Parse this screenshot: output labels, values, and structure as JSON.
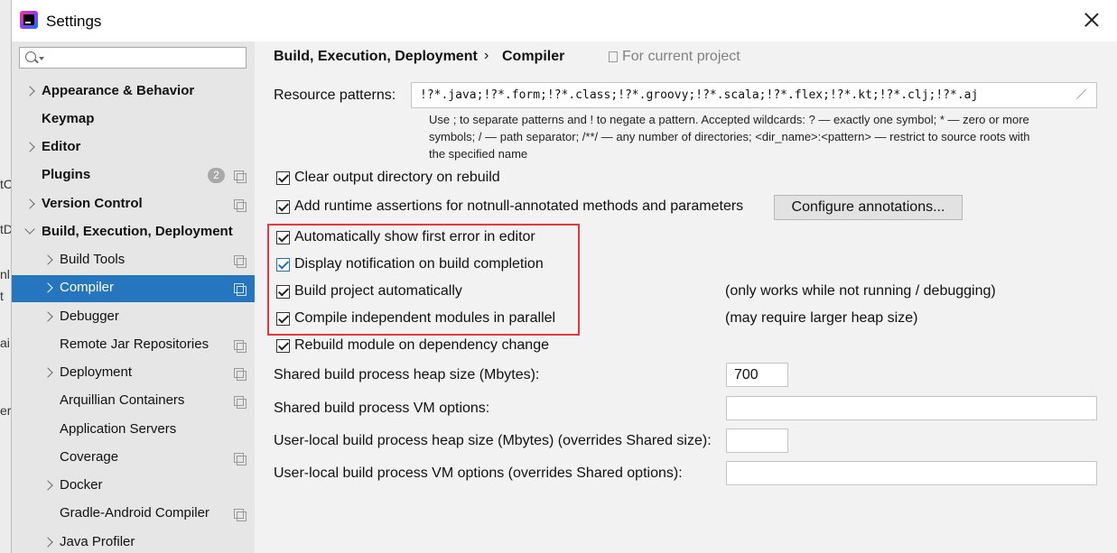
{
  "window": {
    "title": "Settings"
  },
  "background_strip": [
    "tC",
    "tD",
    "nl",
    "t",
    "ai",
    "er"
  ],
  "sidebar": {
    "search_placeholder": "",
    "items": [
      {
        "label": "Appearance & Behavior",
        "bold": true,
        "arrow": "right",
        "level": 0
      },
      {
        "label": "Keymap",
        "bold": true,
        "arrow": "none",
        "level": 0
      },
      {
        "label": "Editor",
        "bold": true,
        "arrow": "right",
        "level": 0
      },
      {
        "label": "Plugins",
        "bold": true,
        "arrow": "none",
        "level": 0,
        "badge": "2",
        "copy": true
      },
      {
        "label": "Version Control",
        "bold": true,
        "arrow": "right",
        "level": 0,
        "copy": true
      },
      {
        "label": "Build, Execution, Deployment",
        "bold": true,
        "arrow": "down",
        "level": 0
      },
      {
        "label": "Build Tools",
        "arrow": "right",
        "level": 1,
        "copy": true
      },
      {
        "label": "Compiler",
        "arrow": "right",
        "level": 1,
        "copy": true,
        "selected": true
      },
      {
        "label": "Debugger",
        "arrow": "right",
        "level": 1
      },
      {
        "label": "Remote Jar Repositories",
        "arrow": "none",
        "level": 1,
        "copy": true
      },
      {
        "label": "Deployment",
        "arrow": "right",
        "level": 1,
        "copy": true
      },
      {
        "label": "Arquillian Containers",
        "arrow": "none",
        "level": 1,
        "copy": true
      },
      {
        "label": "Application Servers",
        "arrow": "none",
        "level": 1
      },
      {
        "label": "Coverage",
        "arrow": "none",
        "level": 1,
        "copy": true
      },
      {
        "label": "Docker",
        "arrow": "right",
        "level": 1
      },
      {
        "label": "Gradle-Android Compiler",
        "arrow": "none",
        "level": 1,
        "copy": true
      },
      {
        "label": "Java Profiler",
        "arrow": "right",
        "level": 1
      }
    ]
  },
  "breadcrumb": {
    "parent": "Build, Execution, Deployment",
    "separator": "›",
    "current": "Compiler",
    "scope_note": "For current project"
  },
  "resource_patterns": {
    "label": "Resource patterns:",
    "value": "!?*.java;!?*.form;!?*.class;!?*.groovy;!?*.scala;!?*.flex;!?*.kt;!?*.clj;!?*.aj",
    "hint_line1": "Use ; to separate patterns and ! to negate a pattern. Accepted wildcards: ? — exactly one symbol; * — zero or more",
    "hint_line2": "symbols; / — path separator; /**/ — any number of directories; <dir_name>:<pattern> — restrict to source roots with",
    "hint_line3": "the specified name"
  },
  "options": {
    "clear_output": {
      "label": "Clear output directory on rebuild",
      "checked": true
    },
    "runtime_assertions": {
      "label": "Add runtime assertions for notnull-annotated methods and parameters",
      "checked": true
    },
    "configure_annotations": "Configure annotations...",
    "show_first_error": {
      "label": "Automatically show first error in editor",
      "checked": true
    },
    "display_notification": {
      "label": "Display notification on build completion",
      "checked": true
    },
    "build_automatically": {
      "label": "Build project automatically",
      "checked": true,
      "note": "(only works while not running / debugging)"
    },
    "compile_parallel": {
      "label": "Compile independent modules in parallel",
      "checked": true,
      "note": "(may require larger heap size)"
    },
    "rebuild_on_dependency": {
      "label": "Rebuild module on dependency change",
      "checked": true
    }
  },
  "fields": {
    "shared_heap": {
      "label": "Shared build process heap size (Mbytes):",
      "value": "700"
    },
    "shared_vm": {
      "label": "Shared build process VM options:",
      "value": ""
    },
    "local_heap": {
      "label": "User-local build process heap size (Mbytes) (overrides Shared size):",
      "value": ""
    },
    "local_vm": {
      "label": "User-local build process VM options (overrides Shared options):",
      "value": ""
    }
  },
  "colors": {
    "selection": "#2675bf",
    "highlight_box": "#e8383d",
    "checkbox_focus": "#1f6ec8"
  }
}
